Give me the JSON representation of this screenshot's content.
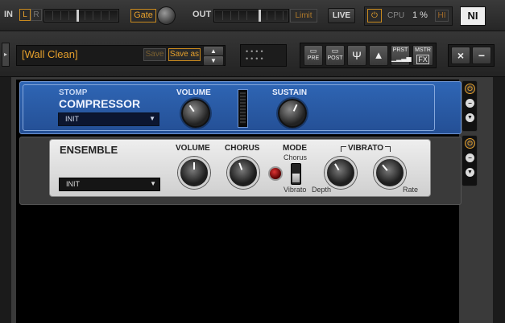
{
  "topbar": {
    "in_label": "IN",
    "l_label": "L",
    "r_label": "R",
    "gate_label": "Gate",
    "out_label": "OUT",
    "limit_label": "Limit",
    "live_label": "LIVE",
    "cpu_label": "CPU",
    "cpu_value": "1 %",
    "hi_label": "HI",
    "logo": "NI"
  },
  "presetbar": {
    "preset_name": "[Wall Clean]",
    "save_label": "Save",
    "save_as_label": "Save as",
    "pre_label": "PRE",
    "post_label": "POST",
    "prst_label": "PRST",
    "mstr_label": "MSTR",
    "fx_label": "FX",
    "close_label": "×",
    "min_label": "−"
  },
  "modules": {
    "compressor": {
      "stomp_label": "STOMP",
      "title": "COMPRESSOR",
      "preset": "INIT",
      "volume_label": "VOLUME",
      "sustain_label": "SUSTAIN"
    },
    "ensemble": {
      "title": "ENSEMBLE",
      "preset": "INIT",
      "volume_label": "VOLUME",
      "chorus_label": "CHORUS",
      "mode_label": "MODE",
      "mode_chorus": "Chorus",
      "mode_vibrato": "Vibrato",
      "vibrato_label": "VIBRATO",
      "depth_label": "Depth",
      "rate_label": "Rate"
    }
  },
  "colors": {
    "accent_orange": "#e6a02c",
    "compressor_blue": "#2d5ea8",
    "ensemble_silver": "#d9d9d9"
  }
}
